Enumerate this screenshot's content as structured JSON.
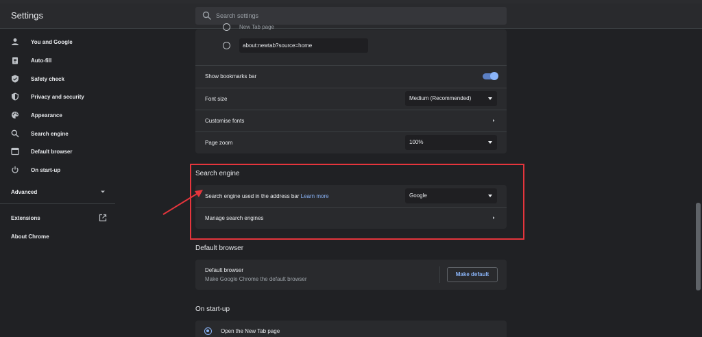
{
  "header": {
    "title": "Settings",
    "search_placeholder": "Search settings"
  },
  "sidebar": {
    "items": [
      {
        "label": "You and Google",
        "icon": "person-icon"
      },
      {
        "label": "Auto-fill",
        "icon": "clipboard-icon"
      },
      {
        "label": "Safety check",
        "icon": "shield-check-icon"
      },
      {
        "label": "Privacy and security",
        "icon": "shield-icon"
      },
      {
        "label": "Appearance",
        "icon": "palette-icon"
      },
      {
        "label": "Search engine",
        "icon": "search-icon"
      },
      {
        "label": "Default browser",
        "icon": "browser-window-icon"
      },
      {
        "label": "On start-up",
        "icon": "power-icon"
      }
    ],
    "advanced": "Advanced",
    "extensions": "Extensions",
    "about": "About Chrome"
  },
  "appearance": {
    "partial_radio_label": "New Tab page",
    "custom_url_value": "about:newtab?source=home",
    "bookmarks_bar_label": "Show bookmarks bar",
    "bookmarks_bar_on": true,
    "font_size_label": "Font size",
    "font_size_value": "Medium (Recommended)",
    "customise_fonts_label": "Customise fonts",
    "page_zoom_label": "Page zoom",
    "page_zoom_value": "100%"
  },
  "search_engine": {
    "title": "Search engine",
    "used_label": "Search engine used in the address bar",
    "learn_more": "Learn more",
    "engine_value": "Google",
    "manage_label": "Manage search engines"
  },
  "default_browser": {
    "title": "Default browser",
    "row_title": "Default browser",
    "row_subtitle": "Make Google Chrome the default browser",
    "button": "Make default"
  },
  "startup": {
    "title": "On start-up",
    "option1": "Open the New Tab page"
  },
  "colors": {
    "background": "#202124",
    "card": "#292a2d",
    "accent": "#8ab4f8",
    "annotation": "#e5353c"
  }
}
